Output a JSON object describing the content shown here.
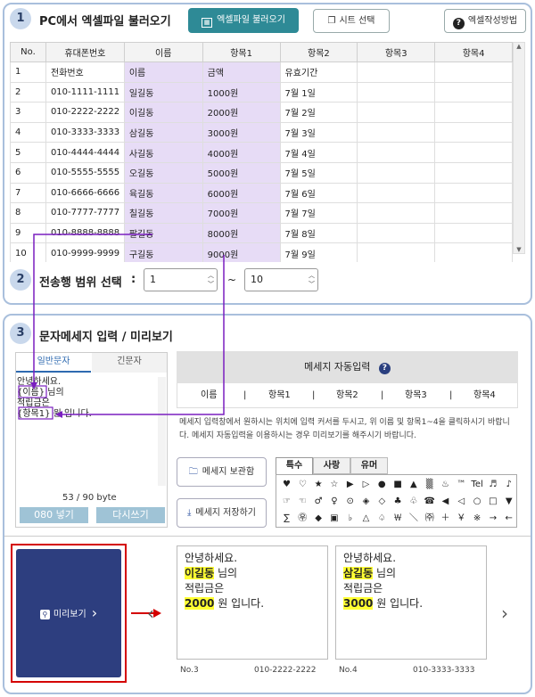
{
  "section1": {
    "number": "1",
    "title": "PC에서 엑셀파일 불러오기",
    "load_button": "엑셀파일 불러오기",
    "sheet_button": "시트 선택",
    "help_button": "엑셀작성방법",
    "columns": [
      "No.",
      "휴대폰번호",
      "이름",
      "항목1",
      "항목2",
      "항목3",
      "항목4"
    ],
    "rows": [
      [
        "1",
        "전화번호",
        "이름",
        "금액",
        "유효기간",
        "",
        ""
      ],
      [
        "2",
        "010-1111-1111",
        "일길동",
        "1000원",
        "7월 1일",
        "",
        ""
      ],
      [
        "3",
        "010-2222-2222",
        "이길동",
        "2000원",
        "7월 2일",
        "",
        ""
      ],
      [
        "4",
        "010-3333-3333",
        "삼길동",
        "3000원",
        "7월 3일",
        "",
        ""
      ],
      [
        "5",
        "010-4444-4444",
        "사길동",
        "4000원",
        "7월 4일",
        "",
        ""
      ],
      [
        "6",
        "010-5555-5555",
        "오길동",
        "5000원",
        "7월 5일",
        "",
        ""
      ],
      [
        "7",
        "010-6666-6666",
        "육길동",
        "6000원",
        "7월 6일",
        "",
        ""
      ],
      [
        "8",
        "010-7777-7777",
        "칠길동",
        "7000원",
        "7월 7일",
        "",
        ""
      ],
      [
        "9",
        "010-8888-8888",
        "팔길동",
        "8000원",
        "7월 8일",
        "",
        ""
      ],
      [
        "10",
        "010-9999-9999",
        "구길동",
        "9000원",
        "7월 9일",
        "",
        ""
      ]
    ]
  },
  "section2": {
    "number": "2",
    "title": "전송행 범위 선택",
    "colon": ":",
    "from_value": "1",
    "tilde": "~",
    "to_value": "10"
  },
  "section3": {
    "number": "3",
    "title": "문자메세지 입력 / 미리보기",
    "tab_general": "일반문자",
    "tab_long": "긴문자",
    "message_lines": [
      "안녕하세요.",
      "{이름} 님의",
      "적립금은",
      "{항목1} 원 입니다."
    ],
    "byte_count": "53 / 90 byte",
    "button_080": "080 넣기",
    "button_rewrite": "다시쓰기",
    "auto_input_title": "메세지 자동입력",
    "auto_fields": [
      "이름",
      "항목1",
      "항목2",
      "항목3",
      "항목4"
    ],
    "separator": "|",
    "description": "메세지 입력창에서 원하시는 위치에 입력 커서를 두시고, 위 이름 및 항목1~4을 클릭하시기 바랍니다. 메세지 자동입력을 이용하시는 경우 미리보기를 해주시기 바랍니다.",
    "msgbox_button": "메세지 보관함",
    "save_button": "메세지 저장하기",
    "symbol_tabs": [
      "특수",
      "사랑",
      "유머"
    ],
    "symbol_rows": [
      [
        "♥",
        "♡",
        "★",
        "☆",
        "▶",
        "▷",
        "●",
        "■",
        "▲",
        "▒",
        "♨",
        "™",
        "Tel",
        "♬",
        "♪"
      ],
      [
        "☞",
        "☜",
        "♂",
        "♀",
        "⊙",
        "◈",
        "◇",
        "♣",
        "♧",
        "☎",
        "◀",
        "◁",
        "○",
        "□",
        "▼"
      ],
      [
        "∑",
        "㉾",
        "◆",
        "▣",
        "♭",
        "△",
        "♤",
        "￦",
        "＼",
        "㈜",
        "＋",
        "￥",
        "※",
        "→",
        "←"
      ]
    ],
    "preview_button": "미리보기",
    "previews": [
      {
        "line1": "안녕하세요.",
        "name": "이길동",
        "line2_suffix": " 님의",
        "line3": "적립금은",
        "amount": "2000",
        "line4_suffix": " 원 입니다.",
        "no": "No.3",
        "phone": "010-2222-2222"
      },
      {
        "line1": "안녕하세요.",
        "name": "삼길동",
        "line2_suffix": " 님의",
        "line3": "적립금은",
        "amount": "3000",
        "line4_suffix": " 원 입니다.",
        "no": "No.4",
        "phone": "010-3333-3333"
      }
    ]
  },
  "colors": {
    "accent": "#2e8a96",
    "border": "#a9bfdc",
    "highlight": "#e7dcf6",
    "preview_bg": "#2d3e7f",
    "arrow": "#7a1fbf",
    "red": "#d40000"
  }
}
